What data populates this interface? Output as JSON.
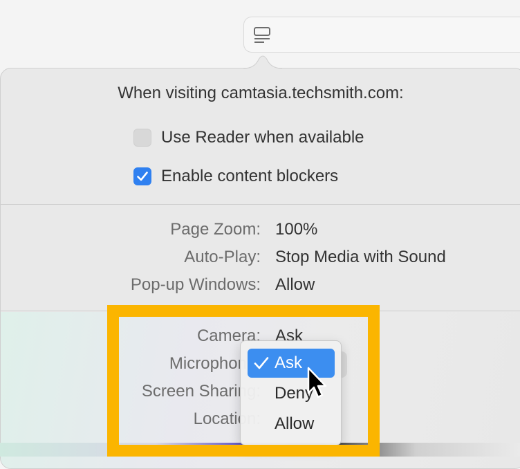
{
  "site_settings": {
    "title": "When visiting camtasia.techsmith.com:",
    "options": [
      {
        "label": "Use Reader when available",
        "checked": false
      },
      {
        "label": "Enable content blockers",
        "checked": true
      }
    ],
    "settings": [
      {
        "label": "Page Zoom:",
        "value": "100%"
      },
      {
        "label": "Auto-Play:",
        "value": "Stop Media with Sound"
      },
      {
        "label": "Pop-up Windows:",
        "value": "Allow"
      },
      {
        "label": "Camera:",
        "value": "Ask"
      },
      {
        "label": "Microphone:",
        "value": "Ask"
      },
      {
        "label": "Screen Sharing:",
        "value": ""
      },
      {
        "label": "Location:",
        "value": ""
      }
    ]
  },
  "permission_menu": {
    "items": [
      {
        "label": "Ask",
        "selected": true
      },
      {
        "label": "Deny",
        "selected": false
      },
      {
        "label": "Allow",
        "selected": false
      }
    ]
  },
  "colors": {
    "accent": "#3c8ef0",
    "checkbox_on": "#2f80f0",
    "highlight_frame": "#fbb500"
  },
  "icons": {
    "reader": "reader-icon",
    "checkmark": "checkmark-icon",
    "cursor": "pointer-cursor-icon"
  }
}
